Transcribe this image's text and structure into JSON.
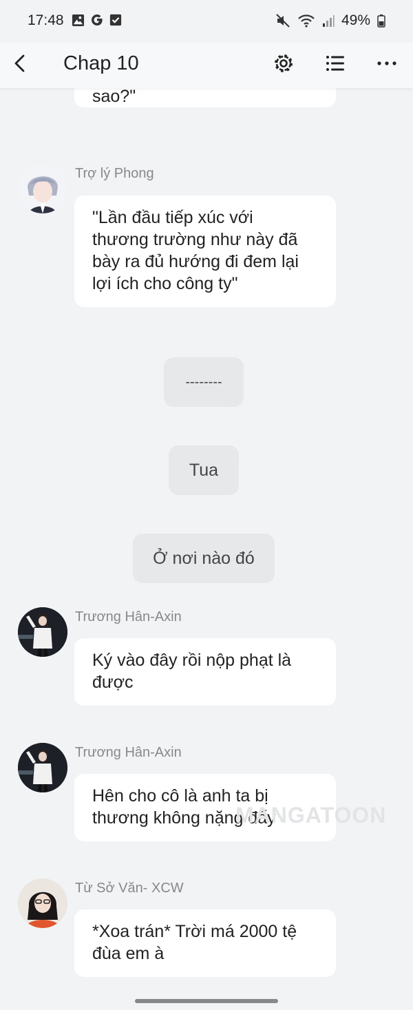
{
  "status": {
    "time": "17:48",
    "battery": "49%",
    "icons": [
      "image-icon",
      "google-g-icon",
      "checkbox-icon",
      "mute-icon",
      "wifi-icon",
      "signal-icon",
      "battery-icon"
    ]
  },
  "header": {
    "title": "Chap 10",
    "icons": [
      "back-arrow-icon",
      "gear-icon",
      "list-icon",
      "more-dots-icon"
    ]
  },
  "messages": [
    {
      "type": "partial",
      "text": "sao?\""
    },
    {
      "type": "msg",
      "sender": "Trợ lý Phong",
      "lines": [
        "\"Lần đầu tiếp xúc với",
        "thương trường như này đã",
        "bày ra đủ hướng đi đem lại",
        "lợi ích cho công ty\""
      ]
    },
    {
      "type": "narration",
      "text": "--------"
    },
    {
      "type": "narration",
      "text": "Tua"
    },
    {
      "type": "narration",
      "text": "Ở nơi nào đó"
    },
    {
      "type": "msg",
      "sender": "Trương Hân-Axin",
      "lines": [
        "Ký vào đây rồi nộp phạt là",
        "được"
      ]
    },
    {
      "type": "msg",
      "sender": "Trương Hân-Axin",
      "lines": [
        "Hên cho cô là anh ta bị",
        "thương không nặng đấy"
      ]
    },
    {
      "type": "msg",
      "sender": "Từ Sở Văn- XCW",
      "lines": [
        "*Xoa trán* Trời má 2000 tệ",
        "đùa em à"
      ]
    }
  ],
  "watermark": "MANGATOON",
  "colors": {
    "background": "#f2f3f5",
    "bubble": "#ffffff",
    "narration": "#e7e8ea",
    "sender": "#888888"
  }
}
